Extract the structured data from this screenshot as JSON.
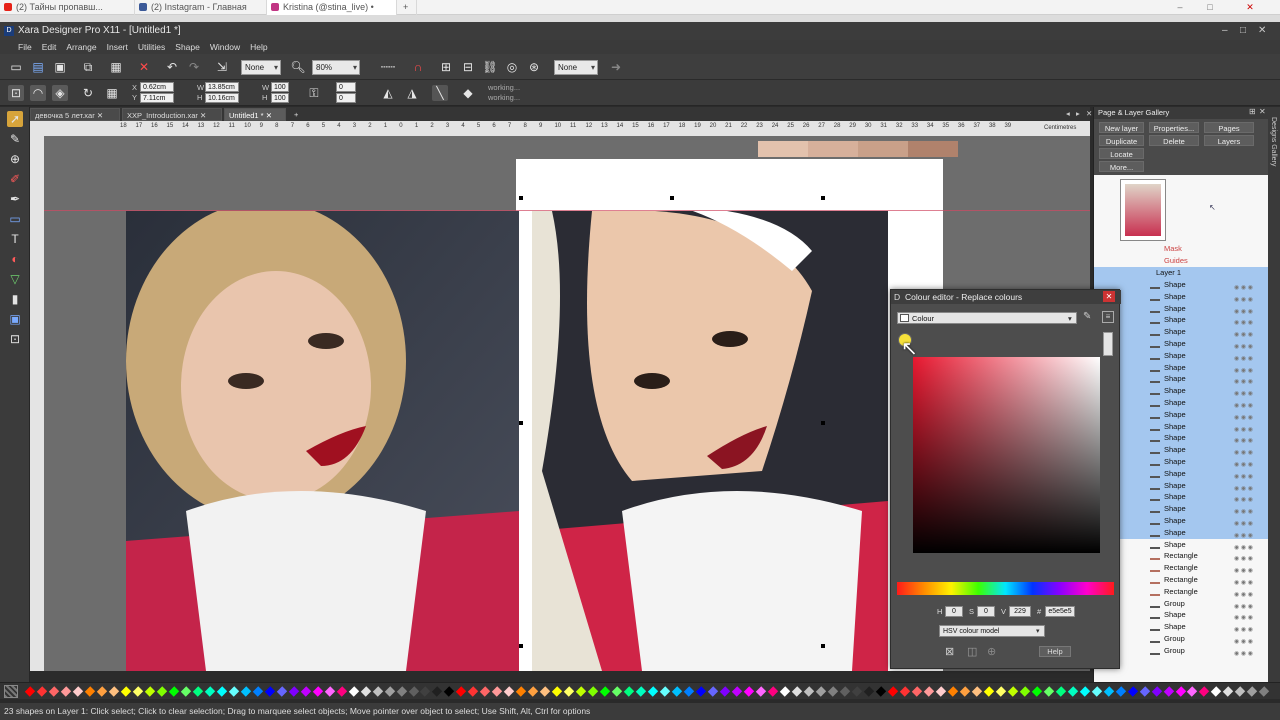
{
  "browser": {
    "tabs": [
      {
        "label": "(2) Тайны пропавш...",
        "icon": "youtube-icon"
      },
      {
        "label": "(2) Instagram - Главная",
        "icon": "facebook-icon"
      },
      {
        "label": "Kristina (@stina_live) •",
        "icon": "instagram-icon"
      }
    ]
  },
  "app": {
    "title": "Xara Designer Pro X11 - [Untitled1 *]",
    "menu": [
      "File",
      "Edit",
      "Arrange",
      "Insert",
      "Utilities",
      "Shape",
      "Window",
      "Help"
    ]
  },
  "toolbar": {
    "fill_combo": "None",
    "zoom_combo": "80%",
    "line_combo": "None",
    "x_value": "0.62cm",
    "y_value": "7.11cm",
    "w_value": "13.85cm",
    "h_value": "10.16cm",
    "w_pct": "100",
    "h_pct": "100",
    "rot_value": "0",
    "skew_value": "0",
    "status_working_1": "working...",
    "status_working_2": "working..."
  },
  "doctabs": [
    {
      "label": "девочка 5 лет.xar"
    },
    {
      "label": "XXP_Introduction.xar"
    },
    {
      "label": "Untitled1 *"
    }
  ],
  "ruler": {
    "unit_label": "Centimetres",
    "ticks": [
      "18",
      "17",
      "16",
      "15",
      "14",
      "13",
      "12",
      "11",
      "10",
      "9",
      "8",
      "7",
      "6",
      "5",
      "4",
      "3",
      "2",
      "1",
      "0",
      "1",
      "2",
      "3",
      "4",
      "5",
      "6",
      "7",
      "8",
      "9",
      "10",
      "11",
      "12",
      "13",
      "14",
      "15",
      "16",
      "17",
      "18",
      "19",
      "20",
      "21",
      "22",
      "23",
      "24",
      "25",
      "26",
      "27",
      "28",
      "29",
      "30",
      "31",
      "32",
      "33",
      "34",
      "35",
      "36",
      "37",
      "38",
      "39"
    ]
  },
  "gallery": {
    "title": "Page & Layer Gallery",
    "buttons": [
      "New layer",
      "Properties...",
      "Pages",
      "Duplicate",
      "Delete",
      "Layers",
      "Locate",
      "More..."
    ],
    "layers": [
      {
        "name": "Mask",
        "sel": false
      },
      {
        "name": "Guides",
        "sel": false
      },
      {
        "name": "Layer 1",
        "sel": false
      }
    ],
    "objects": [
      {
        "name": "Shape",
        "sel": true
      },
      {
        "name": "Shape",
        "sel": true
      },
      {
        "name": "Shape",
        "sel": true
      },
      {
        "name": "Shape",
        "sel": true
      },
      {
        "name": "Shape",
        "sel": true
      },
      {
        "name": "Shape",
        "sel": true
      },
      {
        "name": "Shape",
        "sel": true
      },
      {
        "name": "Shape",
        "sel": true
      },
      {
        "name": "Shape",
        "sel": true
      },
      {
        "name": "Shape",
        "sel": true
      },
      {
        "name": "Shape",
        "sel": true
      },
      {
        "name": "Shape",
        "sel": true
      },
      {
        "name": "Shape",
        "sel": true
      },
      {
        "name": "Shape",
        "sel": true
      },
      {
        "name": "Shape",
        "sel": true
      },
      {
        "name": "Shape",
        "sel": true
      },
      {
        "name": "Shape",
        "sel": true
      },
      {
        "name": "Shape",
        "sel": true
      },
      {
        "name": "Shape",
        "sel": true
      },
      {
        "name": "Shape",
        "sel": true
      },
      {
        "name": "Shape",
        "sel": true
      },
      {
        "name": "Shape",
        "sel": true
      },
      {
        "name": "Shape",
        "sel": false
      },
      {
        "name": "Rectangle",
        "sel": false
      },
      {
        "name": "Rectangle",
        "sel": false
      },
      {
        "name": "Rectangle",
        "sel": false
      },
      {
        "name": "Rectangle",
        "sel": false
      },
      {
        "name": "Group",
        "sel": false
      },
      {
        "name": "Shape",
        "sel": false
      },
      {
        "name": "Shape",
        "sel": false
      },
      {
        "name": "Group",
        "sel": false
      },
      {
        "name": "Group",
        "sel": false
      }
    ],
    "side_label": "Designs Gallery"
  },
  "colour_editor": {
    "title": "Colour editor - Replace colours",
    "colour_name": "Colour",
    "h_label": "H",
    "s_label": "S",
    "v_label": "V",
    "h_value": "0",
    "s_value": "0",
    "v_value": "229",
    "hex_label": "#",
    "hex_value": "e5e5e5",
    "model": "HSV colour model",
    "help": "Help",
    "accent": "#e81830"
  },
  "status": {
    "text": "23 shapes on Layer 1: Click select; Click to clear selection; Drag to marquee select objects; Move pointer over object to select; Use Shift, Alt, Ctrl for options"
  },
  "swatches_top": [
    "#e3c2ad",
    "#d7b09b",
    "#c9a089",
    "#b0826c"
  ],
  "palette_colors": [
    "#ff0000",
    "#ff3333",
    "#ff6666",
    "#ff9999",
    "#ffcccc",
    "#ff8000",
    "#ffa040",
    "#ffc080",
    "#ffff00",
    "#ffff66",
    "#c0ff00",
    "#80ff00",
    "#00ff00",
    "#66ff66",
    "#00ff80",
    "#00ffc0",
    "#00ffff",
    "#66ffff",
    "#00c0ff",
    "#0080ff",
    "#0000ff",
    "#6666ff",
    "#8000ff",
    "#c000ff",
    "#ff00ff",
    "#ff66ff",
    "#ff0080",
    "#ffffff",
    "#e0e0e0",
    "#c0c0c0",
    "#a0a0a0",
    "#808080",
    "#606060",
    "#404040",
    "#202020",
    "#000000"
  ]
}
